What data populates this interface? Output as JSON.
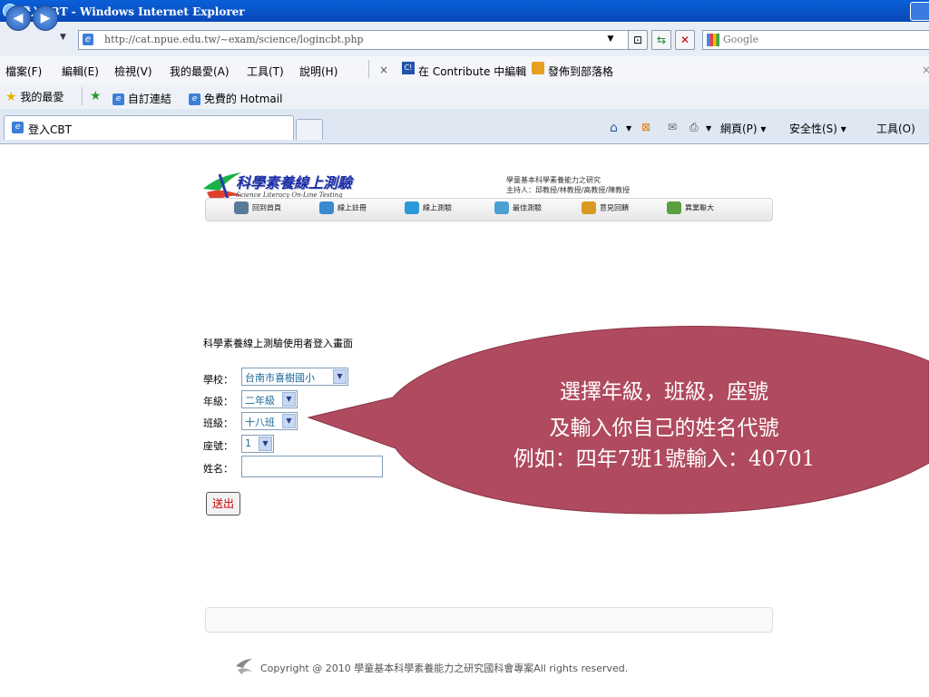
{
  "window": {
    "title": "登入CBT - Windows Internet Explorer"
  },
  "address": {
    "url": "http://cat.npue.edu.tw/~exam/science/logincbt.php",
    "search_placeholder": "Google"
  },
  "menu": [
    "檔案(F)",
    "編輯(E)",
    "檢視(V)",
    "我的最愛(A)",
    "工具(T)",
    "說明(H)"
  ],
  "contribute": {
    "close": "×",
    "edit": "在 Contribute 中編輯",
    "publish": "發佈到部落格",
    "badge": "C!"
  },
  "favorites": {
    "label": "我的最愛",
    "links": [
      "自訂連結",
      "免費的 Hotmail"
    ]
  },
  "tab": {
    "title": "登入CBT"
  },
  "commands": [
    "網頁(P)",
    "安全性(S)",
    "工具(O)"
  ],
  "site": {
    "logo_title": "科學素養線上測驗",
    "logo_subtitle": "Science Literacy On-Line Testing",
    "header_line1": "學童基本科學素養能力之研究",
    "header_line2": "主持人：邱教授/林教授/高教授/陳教授",
    "nav": [
      "回到首頁",
      "線上註冊",
      "線上測驗",
      "最佳測驗",
      "意見回饋",
      "異業聯大"
    ]
  },
  "form": {
    "title": "科學素養線上測驗使用者登入畫面",
    "school_label": "學校：",
    "school_value": "台南市喜樹國小",
    "grade_label": "年級：",
    "grade_value": "二年級",
    "class_label": "班級：",
    "class_value": "十八班",
    "seat_label": "座號：",
    "seat_value": "1",
    "name_label": "姓名：",
    "name_value": "",
    "submit_label": "送出"
  },
  "callout": {
    "line1": "選擇年級，班級，座號",
    "line2": "及輸入你自己的姓名代號",
    "line3": "例如：四年7班1號輸入：40701",
    "color": "#b04a5e"
  },
  "footer": {
    "copyright": "Copyright @ 2010 學童基本科學素養能力之研究國科會專案All rights reserved."
  }
}
